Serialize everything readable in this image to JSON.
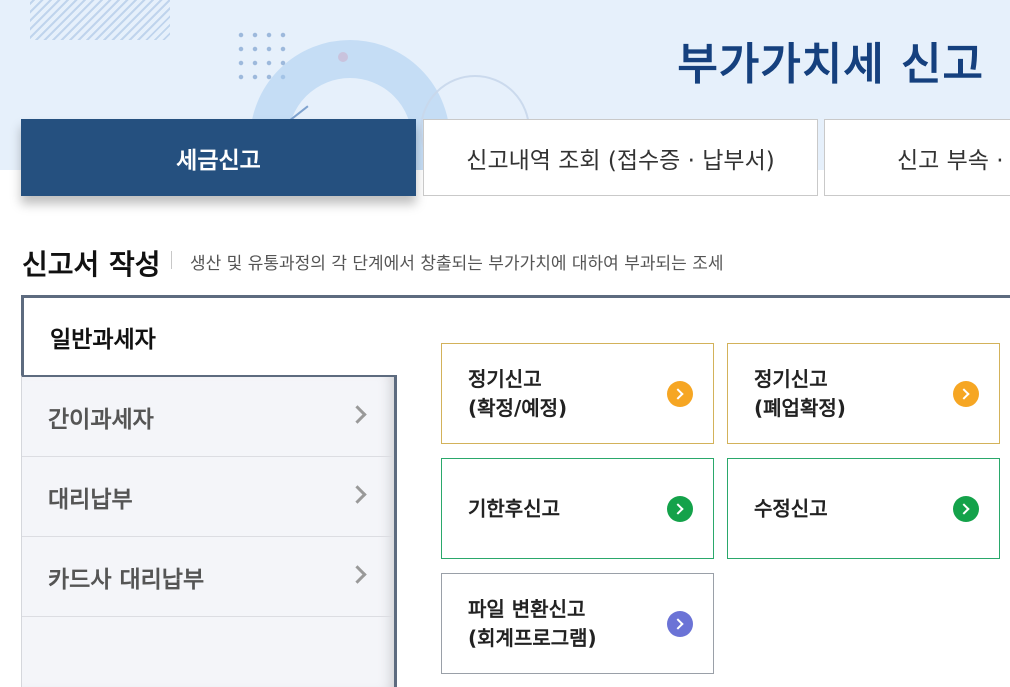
{
  "page": {
    "title": "부가가치세 신고"
  },
  "tabs": [
    {
      "label": "세금신고",
      "active": true
    },
    {
      "label": "신고내역 조회 (접수증 · 납부서)",
      "active": false
    },
    {
      "label": "신고 부속 · ",
      "active": false
    }
  ],
  "section": {
    "title": "신고서 작성",
    "description": "생산 및 유통과정의 각 단계에서 창출되는 부가가치에 대하여 부과되는 조세"
  },
  "sidebar": {
    "items": [
      {
        "label": "일반과세자",
        "active": true
      },
      {
        "label": "간이과세자",
        "active": false
      },
      {
        "label": "대리납부",
        "active": false
      },
      {
        "label": "카드사 대리납부",
        "active": false
      }
    ]
  },
  "cards": [
    {
      "line1": "정기신고",
      "line2": "(확정/예정)",
      "color": "#f6a623"
    },
    {
      "line1": "정기신고",
      "line2": "(폐업확정)",
      "color": "#f6a623"
    },
    {
      "line1": "기한후신고",
      "line2": "",
      "color": "#14a24a"
    },
    {
      "line1": "수정신고",
      "line2": "",
      "color": "#14a24a"
    },
    {
      "line1": "파일 변환신고",
      "line2": "(회계프로그램)",
      "color": "#6b73d6"
    }
  ],
  "icons": {
    "sidebar_chevron": "chevron-right-icon",
    "card_button": "arrow-right-circle-icon"
  }
}
